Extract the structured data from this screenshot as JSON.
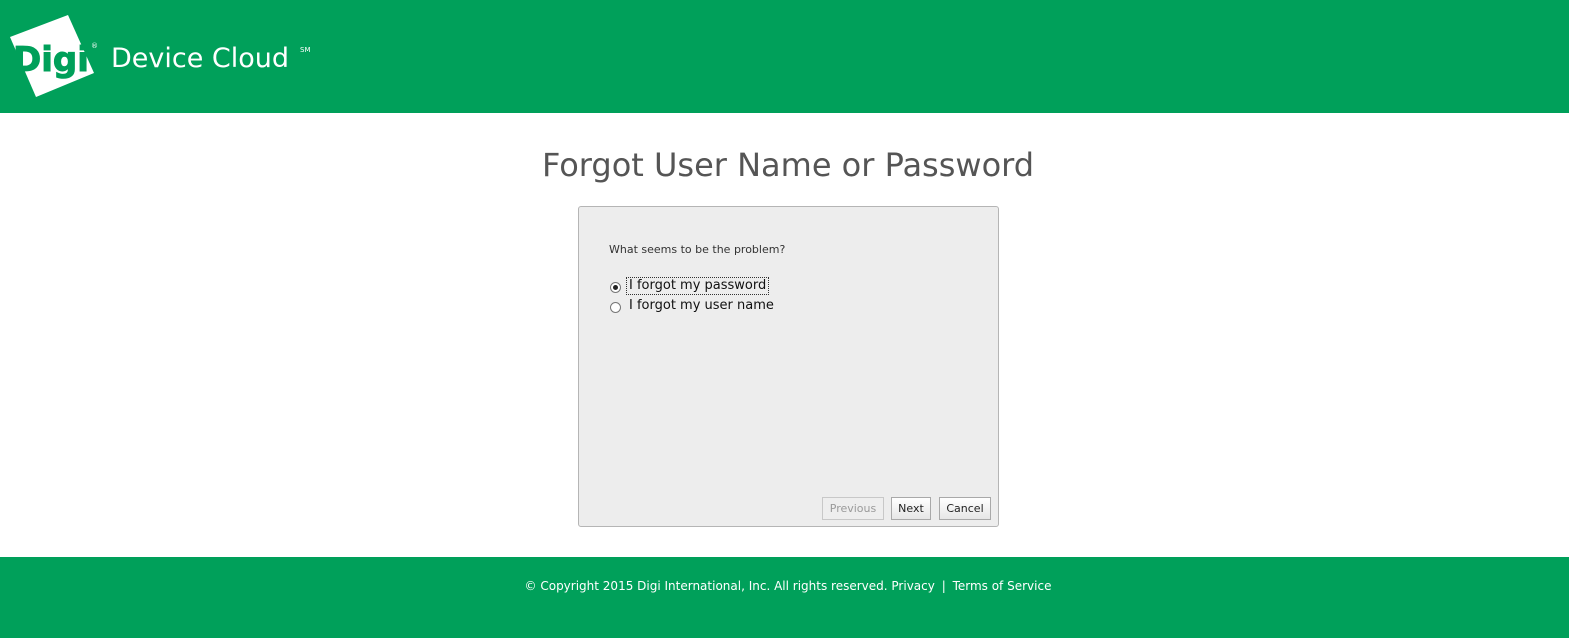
{
  "header": {
    "logo_text": "Digi",
    "logo_mark": "®",
    "brand_name": "Device Cloud",
    "brand_mark": "SM",
    "background": "#00a05a"
  },
  "page": {
    "title": "Forgot User Name or Password"
  },
  "dialog": {
    "question": "What seems to be the problem?",
    "options": [
      {
        "label": "I forgot my password",
        "selected": true
      },
      {
        "label": "I forgot my user name",
        "selected": false
      }
    ],
    "buttons": {
      "previous": "Previous",
      "next": "Next",
      "cancel": "Cancel"
    },
    "previous_disabled": true
  },
  "footer": {
    "copyright": "© Copyright 2015 Digi International, Inc. All rights reserved.",
    "privacy_link": "Privacy",
    "separator": "|",
    "terms_link": "Terms of Service"
  }
}
